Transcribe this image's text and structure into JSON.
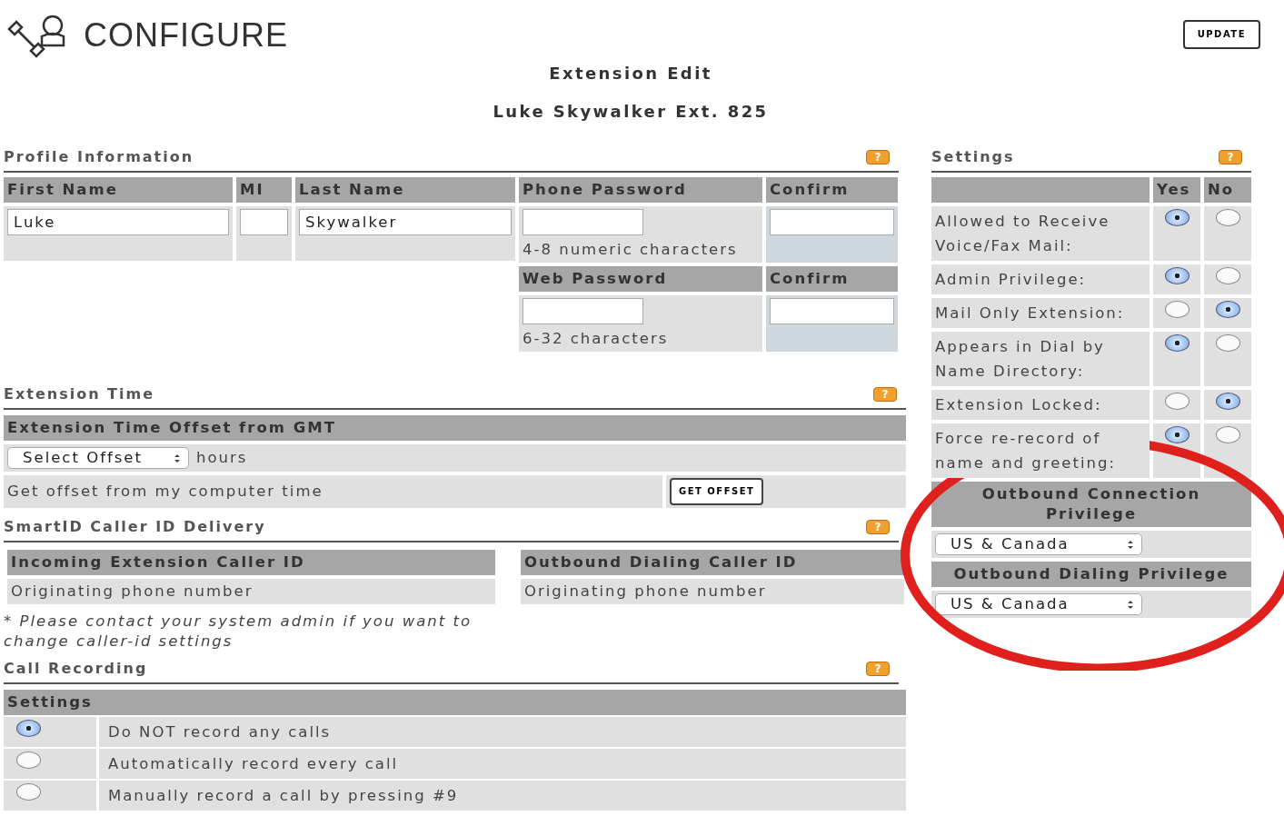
{
  "header": {
    "title": "CONFIGURE",
    "update_button": "UPDATE"
  },
  "page_title": "Extension Edit",
  "subtitle": "Luke Skywalker Ext. 825",
  "profile": {
    "title": "Profile Information",
    "help": "?",
    "name_fields": [
      {
        "label": "First Name",
        "value": "Luke"
      },
      {
        "label": "MI"
      },
      {
        "label": "Last Name",
        "value": "Skywalker"
      }
    ],
    "passwords": [
      {
        "label": "Phone Password",
        "hint": "4-8 numeric characters",
        "confirm_label": "Confirm"
      },
      {
        "label": "Web Password",
        "hint": "6-32 characters",
        "confirm_label": "Confirm"
      }
    ]
  },
  "extension_time": {
    "title": "Extension Time",
    "help": "?",
    "header": "Extension Time Offset from GMT",
    "offset_select": "Select Offset",
    "unit": "hours",
    "computer_time_label": "Get offset from my computer time",
    "button": "GET OFFSET"
  },
  "caller_id": {
    "title": "SmartID Caller ID Delivery",
    "help": "?",
    "columns": [
      {
        "header": "Incoming Extension Caller ID",
        "value": "Originating phone number"
      },
      {
        "header": "Outbound Dialing Caller ID",
        "value": "Originating phone number"
      }
    ],
    "note": "* Please contact your system admin if you want to change caller-id settings"
  },
  "call_recording": {
    "title": "Call Recording",
    "help": "?",
    "header": "Settings",
    "options": [
      {
        "label": "Do NOT record any calls",
        "selected": true
      },
      {
        "label": "Automatically record every call",
        "selected": false
      },
      {
        "label": "Manually record a call by pressing #9",
        "selected": false
      }
    ]
  },
  "settings": {
    "title": "Settings",
    "help": "?",
    "columns": [
      "Yes",
      "No"
    ],
    "rows": [
      {
        "label": "Allowed to Receive Voice/Fax Mail:",
        "yes_selected": true
      },
      {
        "label": "Admin Privilege:",
        "yes_selected": true
      },
      {
        "label": "Mail Only Extension:",
        "yes_selected": false
      },
      {
        "label": "Appears in Dial by Name Directory:",
        "yes_selected": true
      },
      {
        "label": "Extension Locked:",
        "yes_selected": false
      },
      {
        "label": "Force re-record of name and greeting:",
        "yes_selected": true
      }
    ],
    "privileges": [
      {
        "header": "Outbound Connection Privilege",
        "value": "US & Canada"
      },
      {
        "header": "Outbound Dialing Privilege",
        "value": "US & Canada"
      }
    ]
  },
  "annotation_circle": true
}
